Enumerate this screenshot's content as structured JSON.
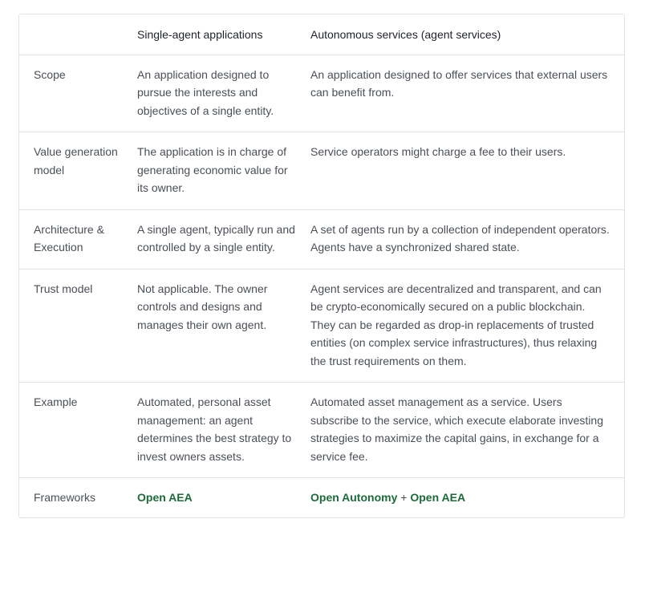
{
  "header": {
    "col1": "",
    "col2": "Single-agent applications",
    "col3": "Autonomous services (agent services)"
  },
  "rows": [
    {
      "label": "Scope",
      "single": "An application designed to pursue the interests and objectives of a single entity.",
      "services": "An application designed to offer services that external users can benefit from."
    },
    {
      "label": "Value generation model",
      "single": "The application is in charge of generating economic value for its owner.",
      "services": "Service operators might charge a fee to their users."
    },
    {
      "label": "Architecture & Execution",
      "single": "A single agent, typically run and controlled by a single entity.",
      "services": "A set of agents run by a collection of independent operators. Agents have a synchronized shared state."
    },
    {
      "label": "Trust model",
      "single": "Not applicable. The owner controls and designs and manages their own agent.",
      "services": "Agent services are decentralized and transparent, and can be crypto-economically secured on a public blockchain. They can be regarded as drop-in replacements of trusted entities (on complex service infrastructures), thus relaxing the trust requirements on them."
    },
    {
      "label": "Example",
      "single": "Automated, personal asset management: an agent determines the best strategy to invest owners assets.",
      "services": "Automated asset management as a service. Users subscribe to the service, which execute elaborate investing strategies to maximize the capital gains, in exchange for a service fee."
    }
  ],
  "frameworks": {
    "label": "Frameworks",
    "single_link": "Open AEA",
    "services_link_1": "Open Autonomy",
    "plus": " + ",
    "services_link_2": "Open AEA"
  },
  "colors": {
    "link": "#1b6b3a",
    "border": "#e2e4e7",
    "text": "#4a4f57"
  }
}
